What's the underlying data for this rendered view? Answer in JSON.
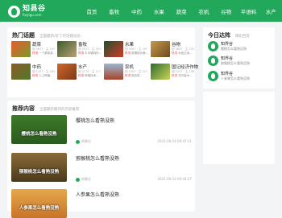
{
  "header": {
    "logo_cn": "知县谷",
    "logo_en": "Ruyigu.com",
    "nav": [
      "首页",
      "畜牧",
      "中药",
      "水果",
      "蔬菜",
      "农机",
      "谷物",
      "平语料",
      "水产"
    ]
  },
  "topics": {
    "title": "热门话题",
    "subtitle": "全面最新/近了的话题动态",
    "items": [
      {
        "name": "蔬菜",
        "meta": "回 4617 · 主 247",
        "hot_label": "热词",
        "hot": "一个蔬菜类..."
      },
      {
        "name": "畜牧",
        "meta": "回 2017 · 主 203",
        "hot_label": "热词",
        "hot": "牛羊猪鸡的..."
      },
      {
        "name": "水果",
        "meta": "回 5407 · 主 297",
        "hot_label": "热词",
        "hot": "猕猴桃价格..."
      },
      {
        "name": "谷物",
        "meta": "回 3647 · 主 219",
        "hot_label": "热词",
        "hot": "水稻玉米..."
      },
      {
        "name": "中药",
        "meta": "回 1107 · 主 263",
        "hot_label": "热词",
        "hot": "人工种植..."
      },
      {
        "name": "水产",
        "meta": "回 2170 · 主 117",
        "hot_label": "热词",
        "hot": "养殖技术..."
      },
      {
        "name": "农机",
        "meta": "回 1007 · 主 117",
        "hot_label": "热词",
        "hot": "拖拉机..."
      },
      {
        "name": "国记经济作物",
        "meta": "回 1107 · 主 108",
        "hot_label": "热词",
        "hot": "花卉苗木..."
      }
    ]
  },
  "recommend": {
    "title": "推荐内容",
    "subtitle": "全面最新最热的内容推荐",
    "items": [
      {
        "caption": "樱桃怎么看熟没熟",
        "title": "樱桃怎么看熟没熟",
        "author": "知悬谷",
        "date": "2021-09-24 09:47:11"
      },
      {
        "caption": "猕猴桃怎么看熟没熟",
        "title": "猕猴桃怎么看熟没熟",
        "author": "知悬谷",
        "date": "2021-09-24 09:44:27"
      },
      {
        "caption": "人参果怎么看熟没熟",
        "title": "人参果怎么看熟没熟",
        "author": "知悬谷",
        "date": ""
      }
    ]
  },
  "answers": {
    "title": "今日达阵",
    "subtitle": "精彩回答",
    "items": [
      {
        "name": "知界谷",
        "desc": "樱桃怎么看熟没熟"
      },
      {
        "name": "知界谷",
        "desc": "猕猴桃怎么看熟没熟"
      },
      {
        "name": "知界谷",
        "desc": "人参果怎么看熟没熟"
      }
    ]
  }
}
